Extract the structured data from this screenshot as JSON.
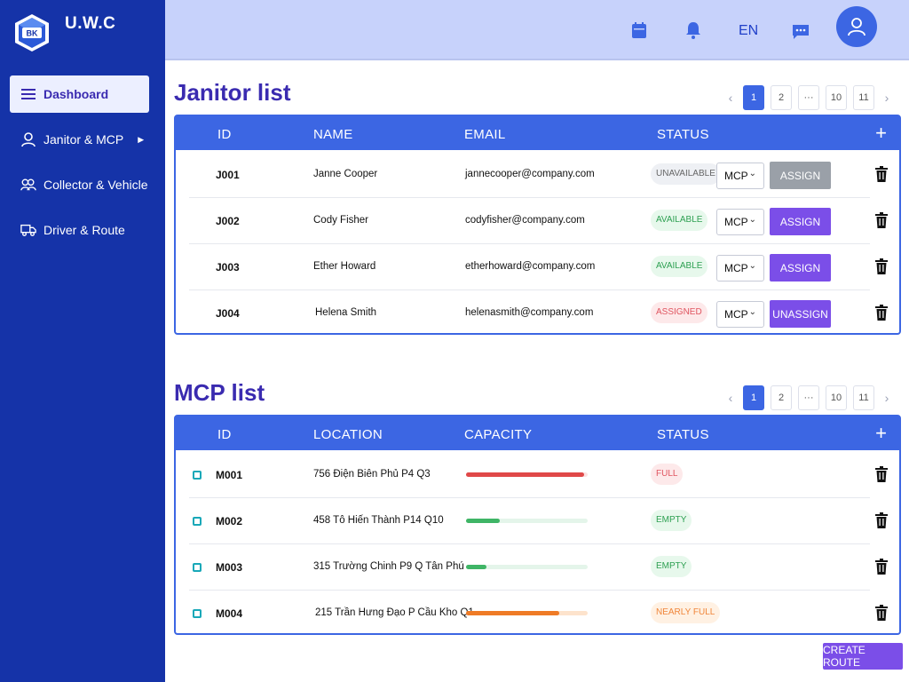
{
  "brand": {
    "logo_text": "BK",
    "name": "U.W.C"
  },
  "sidebar": {
    "items": [
      {
        "label": "Dashboard",
        "icon": "menu-icon"
      },
      {
        "label": "Janitor & MCP",
        "icon": "user-icon"
      },
      {
        "label": "Collector & Vehicle",
        "icon": "users-icon"
      },
      {
        "label": "Driver & Route",
        "icon": "truck-icon"
      }
    ]
  },
  "header": {
    "language": "EN",
    "icons": [
      "calendar-icon",
      "bell-icon",
      "chat-icon",
      "user-icon"
    ]
  },
  "janitor": {
    "title": "Janitor list",
    "columns": [
      "ID",
      "NAME",
      "EMAIL",
      "STATUS"
    ],
    "pagination": [
      "1",
      "2",
      "···",
      "10",
      "11"
    ],
    "rows": [
      {
        "id": "J001",
        "name": "Janne Cooper",
        "email": "jannecooper@company.com",
        "status": "UNAVAILABLE",
        "select": "MCP",
        "action": "ASSIGN"
      },
      {
        "id": "J002",
        "name": "Cody Fisher",
        "email": "codyfisher@company.com",
        "status": "AVAILABLE",
        "select": "MCP",
        "action": "ASSIGN"
      },
      {
        "id": "J003",
        "name": "Ether Howard",
        "email": "etherhoward@company.com",
        "status": "AVAILABLE",
        "select": "MCP",
        "action": "ASSIGN"
      },
      {
        "id": "J004",
        "name": "Helena Smith",
        "email": "helenasmith@company.com",
        "status": "ASSIGNED",
        "select": "MCP",
        "action": "UNASSIGN"
      }
    ]
  },
  "mcp": {
    "title": "MCP list",
    "columns": [
      "ID",
      "LOCATION",
      "CAPACITY",
      "STATUS"
    ],
    "pagination": [
      "1",
      "2",
      "···",
      "10",
      "11"
    ],
    "rows": [
      {
        "id": "M001",
        "location": "756 Điện Biên Phủ P4 Q3",
        "capacity": 0.97,
        "status": "FULL"
      },
      {
        "id": "M002",
        "location": "458 Tô Hiến Thành P14 Q10",
        "capacity": 0.28,
        "status": "EMPTY"
      },
      {
        "id": "M003",
        "location": "315 Trường Chinh P9 Q Tân Phú",
        "capacity": 0.17,
        "status": "EMPTY"
      },
      {
        "id": "M004",
        "location": "215 Trần Hưng Đạo P Cầu Kho Q1",
        "capacity": 0.77,
        "status": "NEARLY FULL"
      }
    ]
  },
  "create_route_label": "CREATE ROUTE",
  "colors": {
    "primary": "#3c66e3",
    "sidebar": "#1533a8",
    "accent": "#7b4ee8",
    "title": "#3a2bb0"
  }
}
